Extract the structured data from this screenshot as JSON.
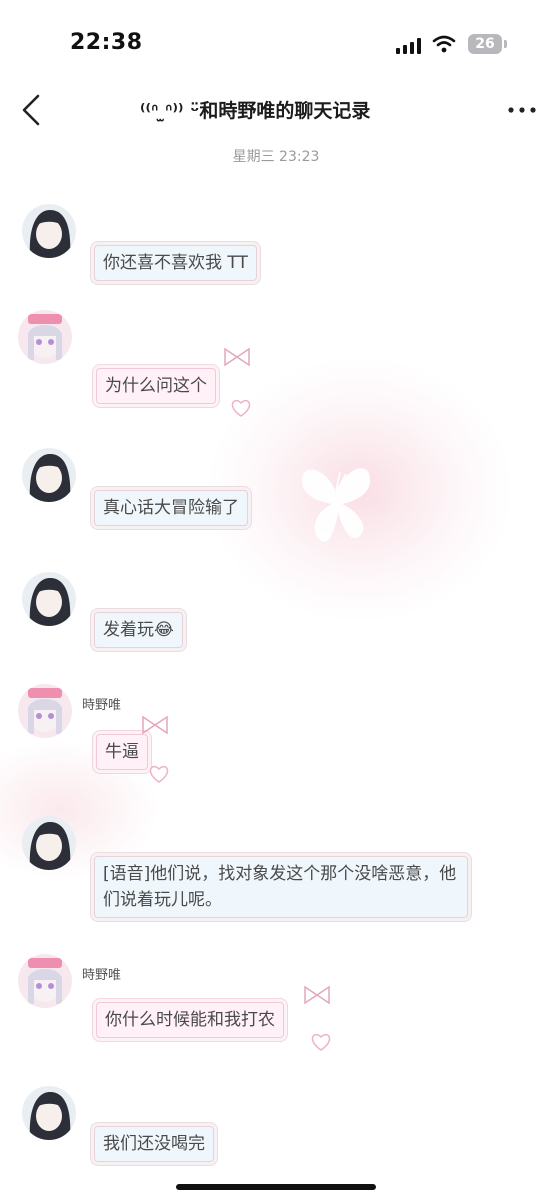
{
  "status_bar": {
    "time": "22:38",
    "battery": "26"
  },
  "header": {
    "title": "⁽⁽ᐢ ̫ᐢ⁾⁾ ᵕ̈和時野唯的聊天记录"
  },
  "chat": {
    "date_separator": "星期三 23:23",
    "messages": [
      {
        "sender": "boy",
        "text": "你还喜不喜欢我 TT"
      },
      {
        "sender": "girl",
        "nickname": "",
        "text": "为什么问这个"
      },
      {
        "sender": "boy",
        "text": "真心话大冒险输了"
      },
      {
        "sender": "boy",
        "text": "发着玩😂"
      },
      {
        "sender": "girl",
        "nickname": "時野唯",
        "text": "牛逼"
      },
      {
        "sender": "boy",
        "text": "[语音]他们说，找对象发这个那个没啥恶意，他们说着玩儿呢。"
      },
      {
        "sender": "girl",
        "nickname": "時野唯",
        "text": "你什么时候能和我打农"
      },
      {
        "sender": "boy",
        "text": "我们还没喝完"
      }
    ]
  },
  "colors": {
    "boy_bubble": "#ecf6fc",
    "girl_bubble": "#fff0f6",
    "accent_pink": "#f4a7c0",
    "text": "#4a4a4a"
  },
  "icons": {
    "back": "chevron-left-icon",
    "more": "more-dots-icon",
    "signal": "cellular-signal-icon",
    "wifi": "wifi-icon",
    "battery": "battery-icon"
  }
}
